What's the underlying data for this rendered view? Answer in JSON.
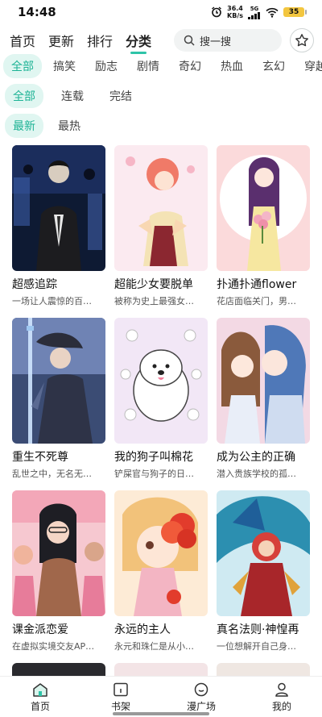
{
  "status_bar": {
    "time": "14:48",
    "speed_value": "36.4",
    "speed_unit": "KB/s",
    "network": "5G",
    "battery": "35"
  },
  "top_nav": {
    "tabs": [
      {
        "label": "首页"
      },
      {
        "label": "更新"
      },
      {
        "label": "排行"
      },
      {
        "label": "分类"
      }
    ],
    "active_tab": "分类",
    "search_placeholder": "搜一搜"
  },
  "filters": {
    "genres": [
      "全部",
      "搞笑",
      "励志",
      "剧情",
      "奇幻",
      "热血",
      "玄幻",
      "穿越"
    ],
    "status": [
      "全部",
      "连载",
      "完结"
    ],
    "sort": [
      "最新",
      "最热"
    ]
  },
  "comics": [
    {
      "title": "超感追踪",
      "desc": "一场让人震惊的百…"
    },
    {
      "title": "超能少女要脱单",
      "desc": "被称为史上最强女…"
    },
    {
      "title": "扑通扑通flower",
      "desc": "花店面临关门，男…"
    },
    {
      "title": "重生不死尊",
      "desc": "乱世之中，无名无…"
    },
    {
      "title": "我的狗子叫棉花",
      "desc": "铲屎官与狗子的日…"
    },
    {
      "title": "成为公主的正确",
      "desc": "潜入贵族学校的孤…"
    },
    {
      "title": "课金派恋爱",
      "desc": "在虚拟实境交友AP…"
    },
    {
      "title": "永远的主人",
      "desc": "永元和珠仁是从小…"
    },
    {
      "title": "真名法则·神惶再",
      "desc": "一位想解开自己身…"
    }
  ],
  "bottom_nav": [
    {
      "label": "首页",
      "icon": "home-icon"
    },
    {
      "label": "书架",
      "icon": "bookshelf-icon"
    },
    {
      "label": "漫广场",
      "icon": "plaza-icon"
    },
    {
      "label": "我的",
      "icon": "profile-icon"
    }
  ],
  "colors": {
    "accent": "#2ec4a8",
    "chip_bg": "#e0f6f1",
    "chip_text": "#1db395"
  }
}
